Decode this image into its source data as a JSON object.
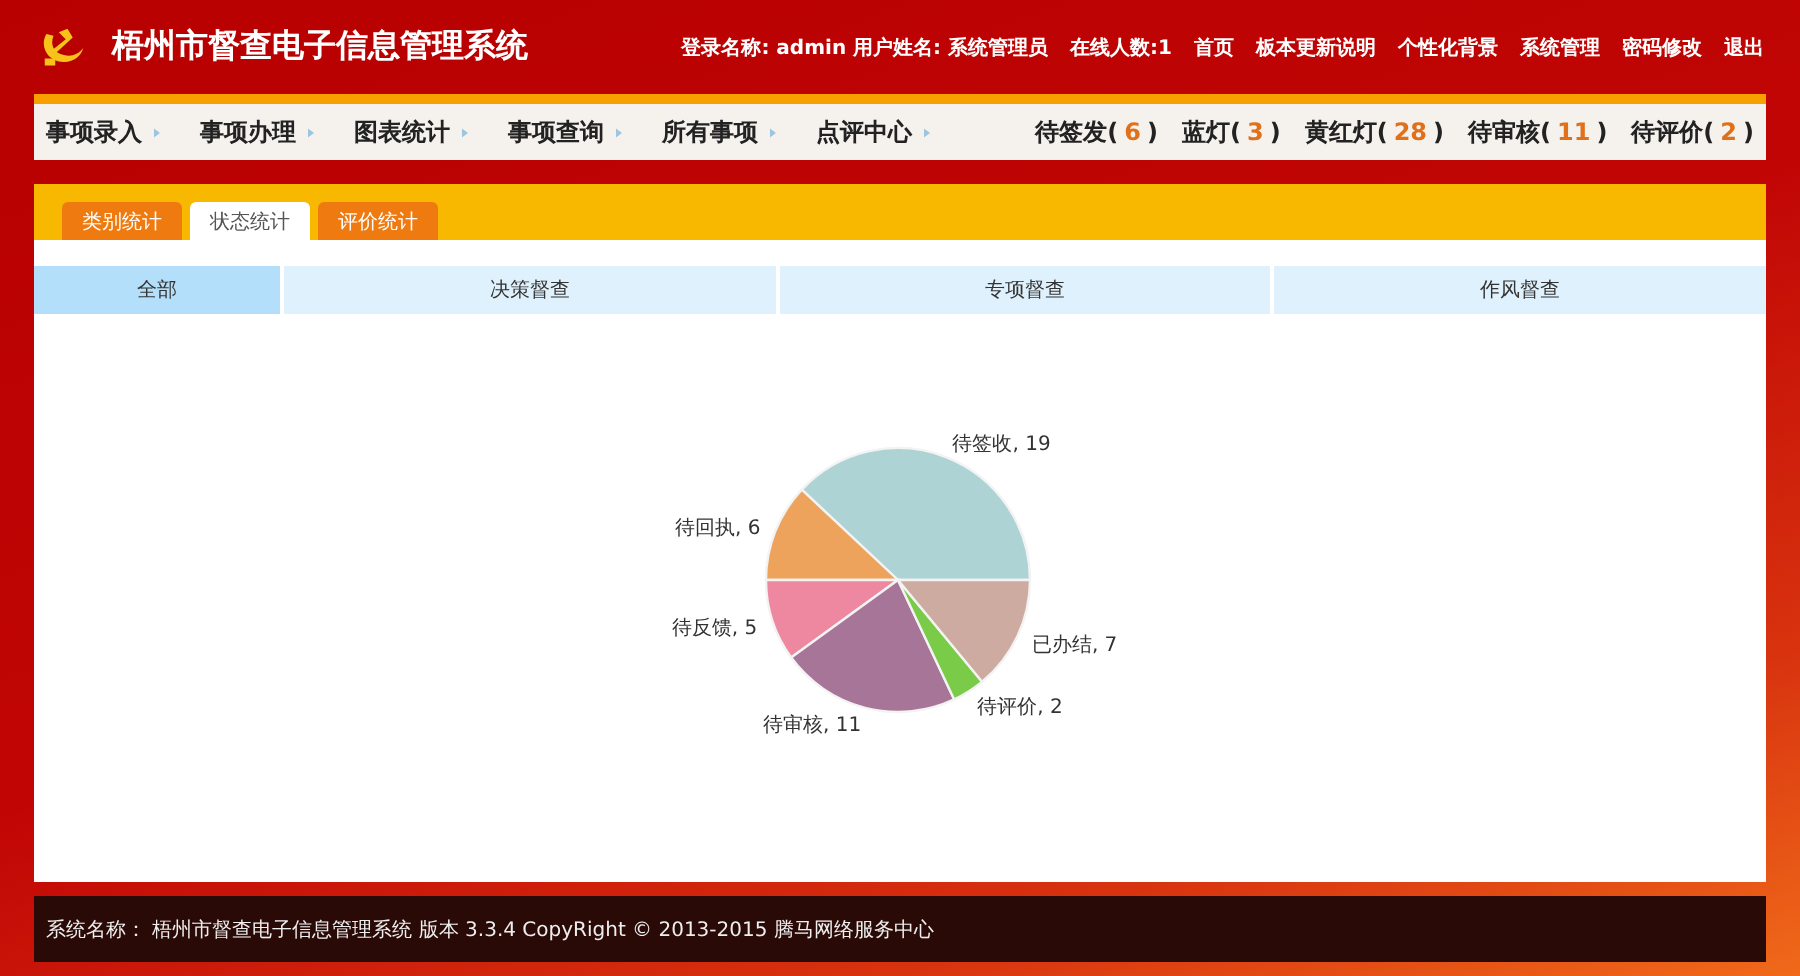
{
  "header": {
    "title": "梧州市督查电子信息管理系统",
    "user_info": "登录名称: admin 用户姓名: 系统管理员",
    "online": "在线人数:1",
    "links": [
      "首页",
      "板本更新说明",
      "个性化背景",
      "系统管理",
      "密码修改",
      "退出"
    ]
  },
  "nav": {
    "items": [
      "事项录入",
      "事项办理",
      "图表统计",
      "事项查询",
      "所有事项",
      "点评中心"
    ],
    "counters": [
      {
        "prefix": "待签发(",
        "count": "6",
        "suffix": ")"
      },
      {
        "prefix": "蓝灯(",
        "count": "3",
        "suffix": ")"
      },
      {
        "prefix": "黄红灯(",
        "count": "28",
        "suffix": ")"
      },
      {
        "prefix": "待审核(",
        "count": "11",
        "suffix": ")"
      },
      {
        "prefix": "待评价(",
        "count": "2",
        "suffix": ")"
      }
    ]
  },
  "tabs": [
    {
      "label": "类别统计",
      "selected": false
    },
    {
      "label": "状态统计",
      "selected": true
    },
    {
      "label": "评价统计",
      "selected": false
    }
  ],
  "subtabs": [
    {
      "label": "全部",
      "selected": true
    },
    {
      "label": "决策督查",
      "selected": false
    },
    {
      "label": "专项督查",
      "selected": false
    },
    {
      "label": "作风督查",
      "selected": false
    }
  ],
  "chart_data": {
    "type": "pie",
    "categories": [
      "待签收, 19",
      "待回执, 6",
      "待反馈, 5",
      "待审核, 11",
      "待评价, 2",
      "已办结, 7"
    ],
    "series": [
      {
        "values": [
          19,
          6,
          5,
          11,
          2,
          7
        ]
      }
    ],
    "colors": [
      "#aed3d5",
      "#eea35c",
      "#ee88a0",
      "#a77598",
      "#7acb47",
      "#cdaba1"
    ]
  },
  "footer": {
    "text": "系统名称： 梧州市督查电子信息管理系统 版本 3.3.4 CopyRight © 2013-2015 腾马网络服务中心"
  }
}
